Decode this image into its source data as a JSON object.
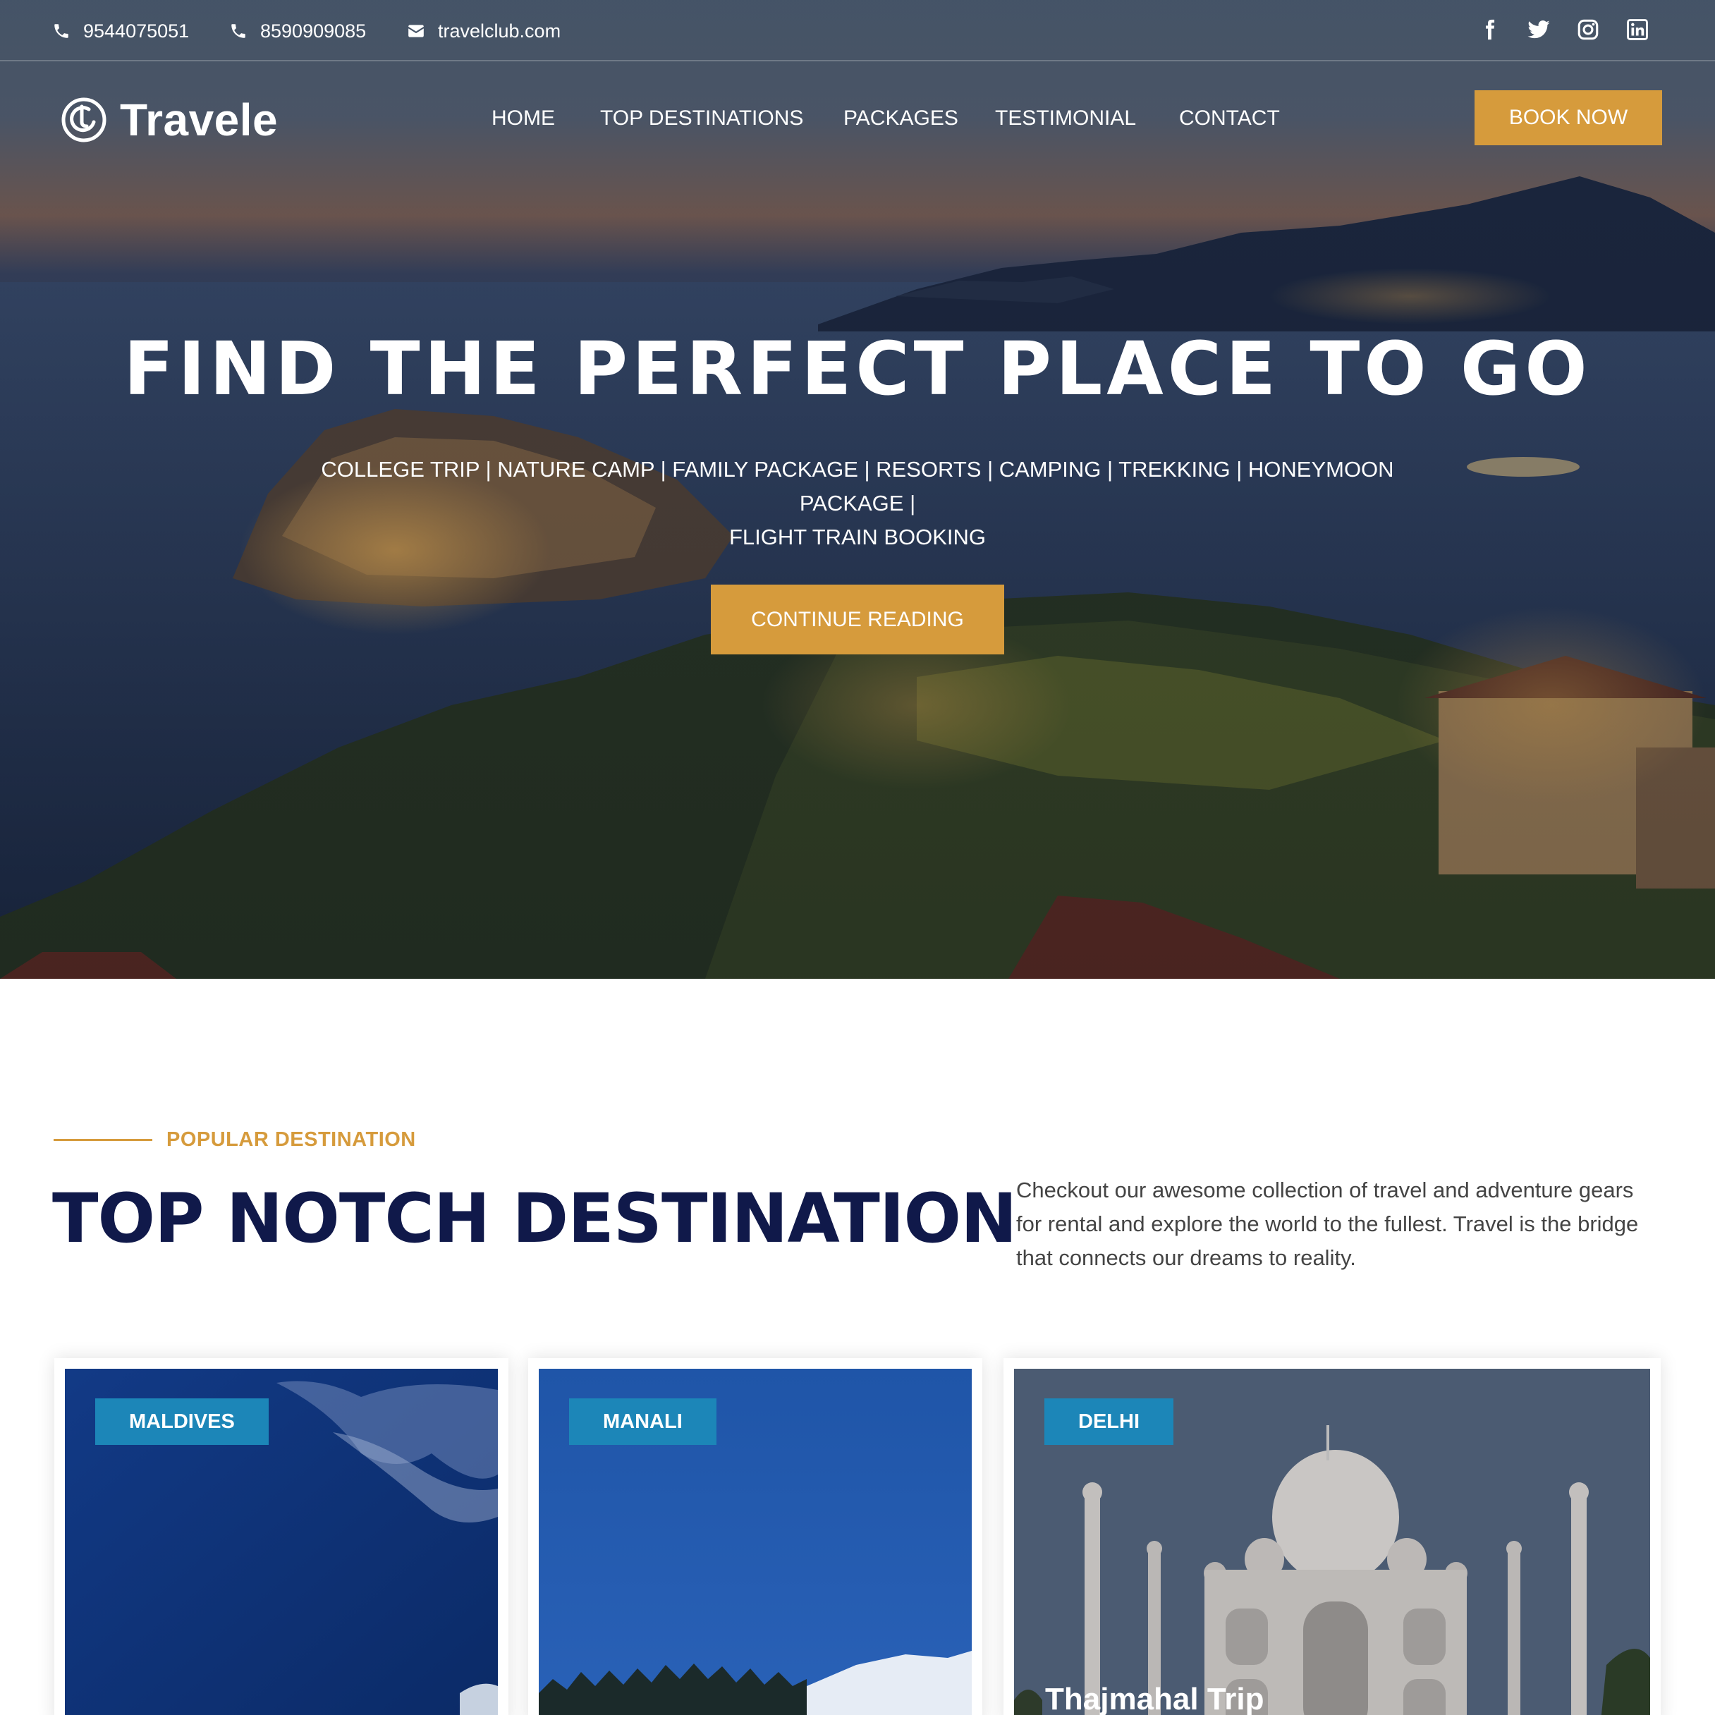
{
  "topbar": {
    "phone1": "9544075051",
    "phone2": "8590909085",
    "email": "travelclub.com",
    "socials": [
      "facebook-icon",
      "twitter-icon",
      "instagram-icon",
      "linkedin-icon"
    ]
  },
  "header": {
    "logo_text": "Travele",
    "nav": [
      "HOME",
      "TOP DESTINATIONS",
      "PACKAGES",
      "TESTIMONIAL",
      "CONTACT"
    ],
    "book_label": "BOOK NOW"
  },
  "hero": {
    "title": "FIND THE PERFECT PLACE TO GO",
    "subtitle_line1": "COLLEGE TRIP | NATURE CAMP | FAMILY PACKAGE | RESORTS | CAMPING | TREKKING | HONEYMOON PACKAGE |",
    "subtitle_line2": "FLIGHT TRAIN BOOKING",
    "cta_label": "CONTINUE READING"
  },
  "destinations": {
    "eyebrow": "POPULAR DESTINATION",
    "title": "TOP NOTCH DESTINATION",
    "description": "Checkout our awesome collection of travel and adventure gears for rental and explore the world to the fullest. Travel is the bridge that connects our dreams to reality.",
    "cards": [
      {
        "tag": "MALDIVES",
        "caption": ""
      },
      {
        "tag": "MANALI",
        "caption": ""
      },
      {
        "tag": "DELHI",
        "caption": "Thajmahal Trip"
      }
    ]
  },
  "colors": {
    "accent": "#d69b3c",
    "navy": "#10194a",
    "tag_blue": "#1c86b8"
  }
}
